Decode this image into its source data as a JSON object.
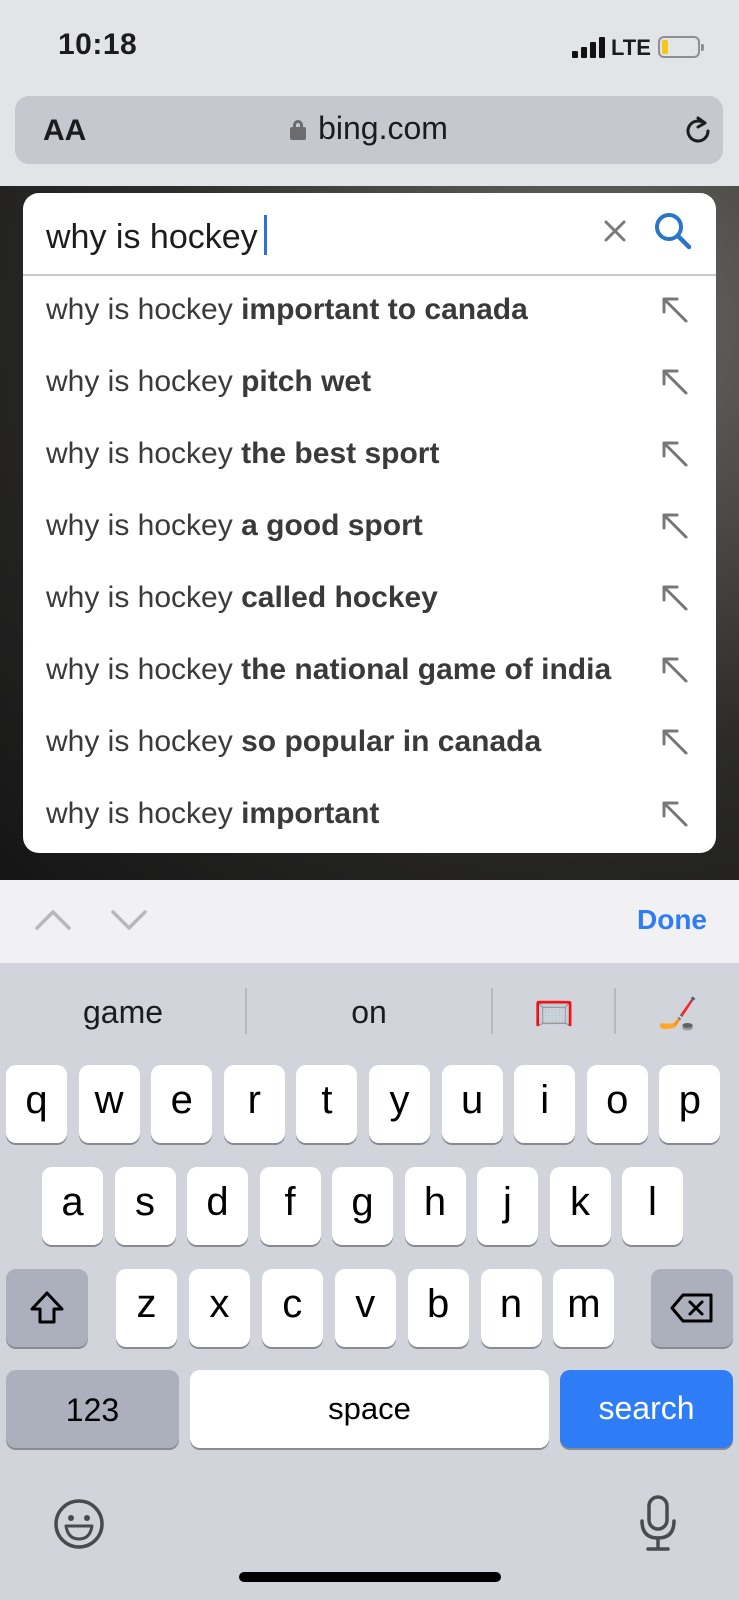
{
  "status": {
    "time": "10:18",
    "network": "LTE"
  },
  "browser": {
    "text_size_label": "AA",
    "url": "bing.com"
  },
  "search": {
    "query": "why is hockey",
    "suggestions": [
      {
        "prefix": "why is hockey",
        "completion": "important to canada"
      },
      {
        "prefix": "why is hockey",
        "completion": "pitch wet"
      },
      {
        "prefix": "why is hockey",
        "completion": "the best sport"
      },
      {
        "prefix": "why is hockey",
        "completion": "a good sport"
      },
      {
        "prefix": "why is hockey",
        "completion": "called hockey"
      },
      {
        "prefix": "why is hockey",
        "completion": "the national game of india"
      },
      {
        "prefix": "why is hockey",
        "completion": "so popular in canada"
      },
      {
        "prefix": "why is hockey",
        "completion": "important"
      }
    ]
  },
  "accessory": {
    "done_label": "Done"
  },
  "keyboard": {
    "predictions": [
      "game",
      "on",
      "🥅",
      "🏒"
    ],
    "row1": [
      "q",
      "w",
      "e",
      "r",
      "t",
      "y",
      "u",
      "i",
      "o",
      "p"
    ],
    "row2": [
      "a",
      "s",
      "d",
      "f",
      "g",
      "h",
      "j",
      "k",
      "l"
    ],
    "row3": [
      "z",
      "x",
      "c",
      "v",
      "b",
      "n",
      "m"
    ],
    "numbers_label": "123",
    "space_label": "space",
    "search_label": "search"
  },
  "colors": {
    "accent": "#2f7df6",
    "caret": "#2c6fe3",
    "search_icon": "#2a75c8"
  }
}
